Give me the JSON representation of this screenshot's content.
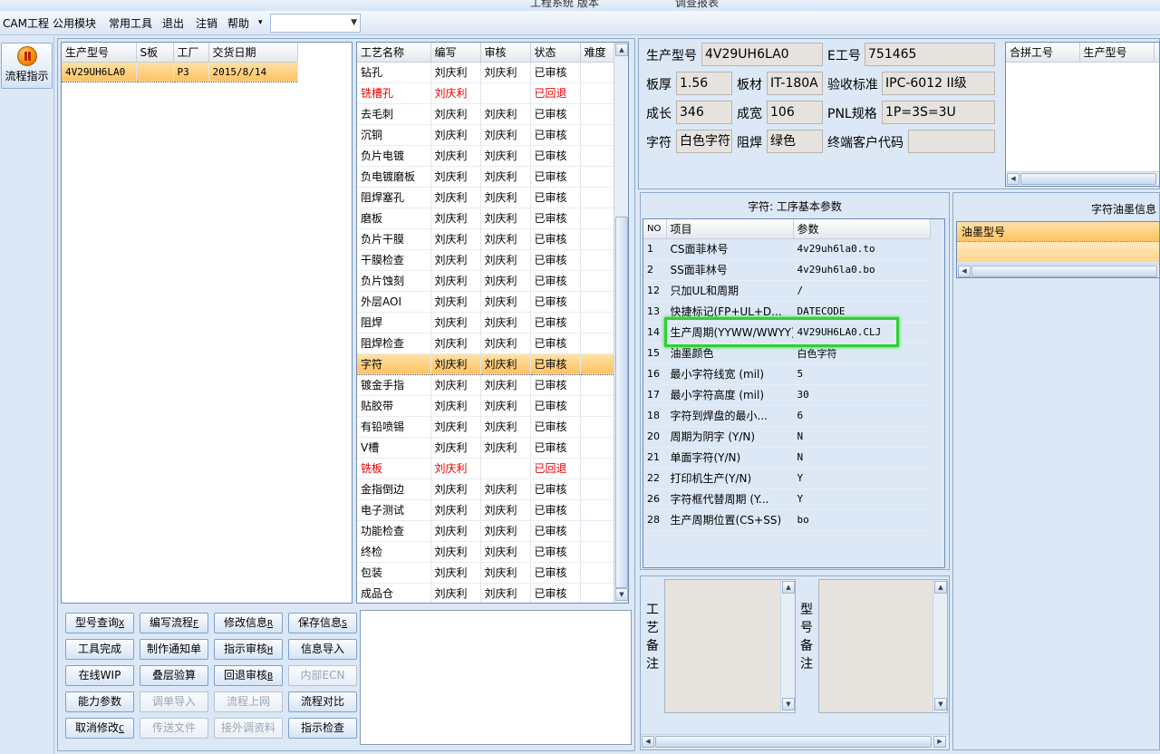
{
  "title_strip": {
    "left": "工程系统 版本",
    "right": "调查报表"
  },
  "menu": [
    "CAM工程",
    "公用模块",
    "常用工具",
    "退出",
    "注销",
    "帮助"
  ],
  "menu_combo_value": "",
  "nav": {
    "flow_button": "流程指示"
  },
  "product_grid": {
    "headers": [
      "生产型号",
      "S板",
      "工厂",
      "交货日期"
    ],
    "rows": [
      [
        "4V29UH6LA0",
        "",
        "P3",
        "2015/8/14"
      ]
    ]
  },
  "process_grid": {
    "headers": [
      "工艺名称",
      "编写",
      "审核",
      "状态",
      "难度"
    ],
    "rows": [
      [
        "钻孔",
        "刘庆利",
        "刘庆利",
        "已审核",
        ""
      ],
      [
        "铣槽孔",
        "刘庆利",
        "",
        "已回退",
        ""
      ],
      [
        "去毛刺",
        "刘庆利",
        "刘庆利",
        "已审核",
        ""
      ],
      [
        "沉铜",
        "刘庆利",
        "刘庆利",
        "已审核",
        ""
      ],
      [
        "负片电镀",
        "刘庆利",
        "刘庆利",
        "已审核",
        ""
      ],
      [
        "负电镀磨板",
        "刘庆利",
        "刘庆利",
        "已审核",
        ""
      ],
      [
        "阻焊塞孔",
        "刘庆利",
        "刘庆利",
        "已审核",
        ""
      ],
      [
        "磨板",
        "刘庆利",
        "刘庆利",
        "已审核",
        ""
      ],
      [
        "负片干膜",
        "刘庆利",
        "刘庆利",
        "已审核",
        ""
      ],
      [
        "干膜检查",
        "刘庆利",
        "刘庆利",
        "已审核",
        ""
      ],
      [
        "负片蚀刻",
        "刘庆利",
        "刘庆利",
        "已审核",
        ""
      ],
      [
        "外层AOI",
        "刘庆利",
        "刘庆利",
        "已审核",
        ""
      ],
      [
        "阻焊",
        "刘庆利",
        "刘庆利",
        "已审核",
        ""
      ],
      [
        "阻焊检查",
        "刘庆利",
        "刘庆利",
        "已审核",
        ""
      ],
      [
        "字符",
        "刘庆利",
        "刘庆利",
        "已审核",
        ""
      ],
      [
        "镀金手指",
        "刘庆利",
        "刘庆利",
        "已审核",
        ""
      ],
      [
        "贴胶带",
        "刘庆利",
        "刘庆利",
        "已审核",
        ""
      ],
      [
        "有铅喷锡",
        "刘庆利",
        "刘庆利",
        "已审核",
        ""
      ],
      [
        "V槽",
        "刘庆利",
        "刘庆利",
        "已审核",
        ""
      ],
      [
        "铣板",
        "刘庆利",
        "",
        "已回退",
        ""
      ],
      [
        "金指倒边",
        "刘庆利",
        "刘庆利",
        "已审核",
        ""
      ],
      [
        "电子测试",
        "刘庆利",
        "刘庆利",
        "已审核",
        ""
      ],
      [
        "功能检查",
        "刘庆利",
        "刘庆利",
        "已审核",
        ""
      ],
      [
        "终检",
        "刘庆利",
        "刘庆利",
        "已审核",
        ""
      ],
      [
        "包装",
        "刘庆利",
        "刘庆利",
        "已审核",
        ""
      ],
      [
        "成品仓",
        "刘庆利",
        "刘庆利",
        "已审核",
        ""
      ]
    ],
    "selected_index": 14,
    "returned_indices": [
      1,
      19
    ]
  },
  "buttons": {
    "query": {
      "label": "型号查询",
      "key": "X"
    },
    "write_flow": {
      "label": "编写流程",
      "key": "F"
    },
    "modify_info": {
      "label": "修改信息",
      "key": "R"
    },
    "save_info": {
      "label": "保存信息",
      "key": "S"
    },
    "tool_done": {
      "label": "工具完成"
    },
    "make_notice": {
      "label": "制作通知单"
    },
    "audit_instruction": {
      "label": "指示审核",
      "key": "H"
    },
    "import_info": {
      "label": "信息导入"
    },
    "online_wip": {
      "label": "在线WIP"
    },
    "stack_check": {
      "label": "叠层验算"
    },
    "rollback_audit": {
      "label": "回退审核",
      "key": "B"
    },
    "internal_ecn": {
      "label": "内部ECN"
    },
    "capability": {
      "label": "能力参数"
    },
    "import_order": {
      "label": "调单导入"
    },
    "flow_online": {
      "label": "流程上网"
    },
    "flow_compare": {
      "label": "流程对比"
    },
    "cancel_modify": {
      "label": "取消修改",
      "key": "C"
    },
    "send_file": {
      "label": "传送文件"
    },
    "ext_material": {
      "label": "接外调资料"
    },
    "check_instruction": {
      "label": "指示检查"
    }
  },
  "info": {
    "model_label": "生产型号",
    "model": "4V29UH6LA0",
    "e_label": "E工号",
    "e_no": "751465",
    "thick_label": "板厚",
    "thick": "1.56",
    "material_label": "板材",
    "material": "IT-180A",
    "std_label": "验收标准",
    "std": "IPC-6012 II级",
    "len_label": "成长",
    "len": "346",
    "wid_label": "成宽",
    "wid": "106",
    "pnl_label": "PNL规格",
    "pnl": "1P=3S=3U",
    "char_label": "字符",
    "char": "白色字符",
    "mask_label": "阻焊",
    "mask": "绿色",
    "cust_label": "终端客户代码",
    "cust": ""
  },
  "merge_grid": {
    "headers": [
      "合拼工号",
      "生产型号",
      ""
    ]
  },
  "params": {
    "title": "字符: 工序基本参数",
    "headers": [
      "NO",
      "项目",
      "参数"
    ],
    "rows": [
      [
        "1",
        "CS面菲林号",
        "4v29uh6la0.to"
      ],
      [
        "2",
        "SS面菲林号",
        "4v29uh6la0.bo"
      ],
      [
        "12",
        "只加UL和周期",
        "/"
      ],
      [
        "13",
        "快捷标记(FP+UL+D...",
        "DATECODE"
      ],
      [
        "14",
        "生产周期(YYWW/WWYY)",
        "4V29UH6LA0.CLJ"
      ],
      [
        "15",
        "油墨颜色",
        "白色字符"
      ],
      [
        "16",
        "最小字符线宽 (mil)",
        "5"
      ],
      [
        "17",
        "最小字符高度 (mil)",
        "30"
      ],
      [
        "18",
        "字符到焊盘的最小...",
        "6"
      ],
      [
        "20",
        "周期为阴字 (Y/N)",
        "N"
      ],
      [
        "21",
        "单面字符(Y/N)",
        "N"
      ],
      [
        "22",
        "打印机生产(Y/N)",
        "Y"
      ],
      [
        "26",
        "字符框代替周期 (Y...",
        "Y"
      ],
      [
        "28",
        "生产周期位置(CS+SS)",
        "bo"
      ]
    ],
    "highlighted_index": 4,
    "highlight_color": "#2fd12f"
  },
  "ink": {
    "title": "字符油墨信息",
    "header": "油墨型号"
  },
  "notes": {
    "process_label": "工艺备注",
    "model_label": "型号备注",
    "process_text": "",
    "model_text": ""
  },
  "colors": {
    "selection": "#ffc262",
    "returned_text": "#e60000",
    "accent": "#2fd12f"
  }
}
